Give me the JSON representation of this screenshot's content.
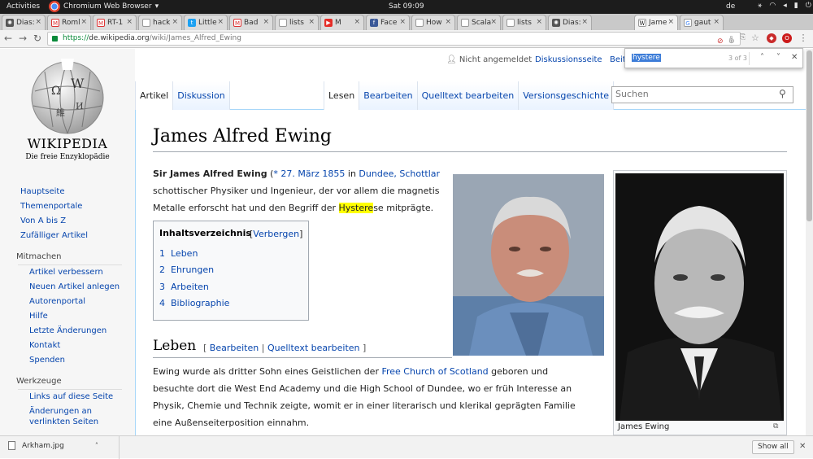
{
  "system": {
    "activities": "Activities",
    "app_name": "Chromium Web Browser",
    "clock": "Sat 09:09",
    "lang": "de"
  },
  "tabs": [
    {
      "label": "Dias:",
      "favicon": "circle-icon"
    },
    {
      "label": "Roml",
      "favicon": "mail-icon"
    },
    {
      "label": "RT-1",
      "favicon": "mail-icon"
    },
    {
      "label": "hack",
      "favicon": "page-icon"
    },
    {
      "label": "Little",
      "favicon": "twitter-icon"
    },
    {
      "label": "Bad",
      "favicon": "mail-icon"
    },
    {
      "label": "lists",
      "favicon": "page-icon"
    },
    {
      "label": "M",
      "favicon": "youtube-icon"
    },
    {
      "label": "Face",
      "favicon": "facebook-icon"
    },
    {
      "label": "How",
      "favicon": "page-icon"
    },
    {
      "label": "Scala",
      "favicon": "page-icon"
    },
    {
      "label": "lists",
      "favicon": "page-icon"
    },
    {
      "label": "Dias:",
      "favicon": "circle-icon"
    },
    {
      "label": "Jame",
      "favicon": "wikipedia-icon"
    },
    {
      "label": "gaut",
      "favicon": "google-icon"
    }
  ],
  "address": {
    "scheme": "https://",
    "host": "de.wikipedia.org",
    "path": "/wiki/James_Alfred_Ewing"
  },
  "find": {
    "query": "hystere",
    "count": "3 of 3"
  },
  "wiki": {
    "logo_title": "Wikipedia",
    "logo_sub": "Die freie Enzyklopädie",
    "personal": {
      "not_logged_in": "Nicht angemeldet",
      "discussion": "Diskussionsseite",
      "contrib": "Beit"
    },
    "nav_main": [
      "Hauptseite",
      "Themenportale",
      "Von A bis Z",
      "Zufälliger Artikel"
    ],
    "mitmachen_head": "Mitmachen",
    "mitmachen": [
      "Artikel verbessern",
      "Neuen Artikel anlegen",
      "Autorenportal",
      "Hilfe",
      "Letzte Änderungen",
      "Kontakt",
      "Spenden"
    ],
    "werkzeuge_head": "Werkzeuge",
    "werkzeuge": [
      "Links auf diese Seite",
      "Änderungen an",
      "verlinkten Seiten"
    ],
    "page_tabs_left": [
      "Artikel",
      "Diskussion"
    ],
    "page_tabs_right": [
      "Lesen",
      "Bearbeiten",
      "Quelltext bearbeiten",
      "Versionsgeschichte"
    ],
    "search_placeholder": "Suchen",
    "title": "James Alfred Ewing",
    "intro": {
      "name": "Sir James Alfred Ewing",
      "paren": " (",
      "born": "* 27. März 1855",
      "in": " in ",
      "place": "Dundee, Schottlar",
      "line2": "schottischer Physiker und Ingenieur, der vor allem die magnetis",
      "line3_pre": "Metalle erforscht hat und den Begriff der ",
      "line3_hl": "Hystere",
      "line3_hl2": "se",
      "line3_post": " mitprägte."
    },
    "toc": {
      "heading": "Inhaltsverzeichnis",
      "toggle_open": "[",
      "toggle_link": "Verbergen",
      "toggle_close": "]",
      "items": [
        {
          "num": "1",
          "label": "Leben"
        },
        {
          "num": "2",
          "label": "Ehrungen"
        },
        {
          "num": "3",
          "label": "Arbeiten"
        },
        {
          "num": "4",
          "label": "Bibliographie"
        }
      ]
    },
    "section_leben": "Leben",
    "edit": {
      "open": "[ ",
      "edit": "Bearbeiten",
      "sep": " | ",
      "source": "Quelltext bearbeiten",
      "close": " ]"
    },
    "leben_p": {
      "pre": "Ewing wurde als dritter Sohn eines Geistlichen der ",
      "link": "Free Church of Scotland",
      "post": " geboren und",
      "line2": "besuchte dort die West End Academy und die High School of Dundee, wo er früh Interesse an",
      "line3": "Physik, Chemie und Technik zeigte, womit er in einer literarisch und klerikal geprägten Familie",
      "line4": "eine Außenseiterposition einnahm."
    },
    "caption": "James Ewing"
  },
  "downloads": {
    "file": "Arkham.jpg",
    "show_all": "Show all"
  }
}
